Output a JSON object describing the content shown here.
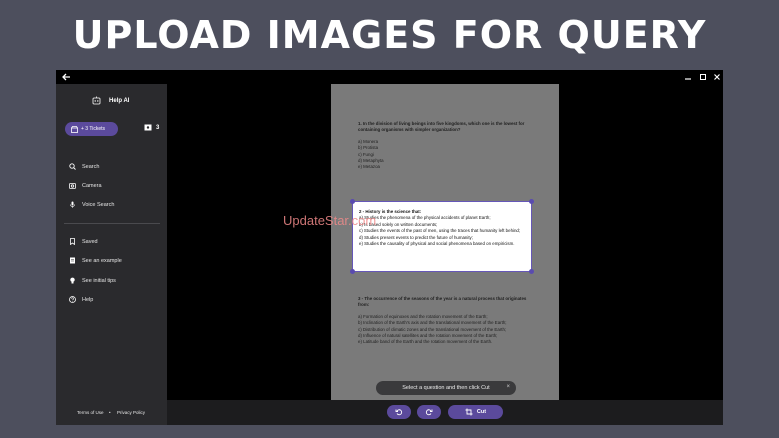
{
  "banner": {
    "title": "UPLOAD IMAGES FOR QUERY"
  },
  "sidebar": {
    "brand": "Help AI",
    "tickets_button": "+ 3 Tickets",
    "ticket_count": "3",
    "nav": [
      {
        "label": "Search",
        "icon": "search-icon"
      },
      {
        "label": "Camera",
        "icon": "camera-icon"
      },
      {
        "label": "Voice Search",
        "icon": "microphone-icon"
      },
      {
        "label": "Saved",
        "icon": "bookmark-icon"
      },
      {
        "label": "See an example",
        "icon": "document-icon"
      },
      {
        "label": "See initial tips",
        "icon": "lightbulb-icon"
      },
      {
        "label": "Help",
        "icon": "help-icon"
      }
    ],
    "footer": {
      "terms": "Terms of Use",
      "separator": "•",
      "privacy": "Privacy Policy"
    }
  },
  "document": {
    "q1_title": "1. In the division of living beings into five kingdoms, which one is the lowest for containing organisms with simpler organization?",
    "q1_options": [
      "a) Monera",
      "b) Protista",
      "c) Fungi",
      "d) Metaphyta",
      "e) Metazoa"
    ],
    "q2_title": "2 - History is the science that:",
    "q2_options": [
      "a) Studies the phenomena of the physical accidents of planet Earth;",
      "b) Is based solely on written documents;",
      "c) Studies the events of the past of men, using the traces that humanity left behind;",
      "d) Studies present events to predict the future of humanity;",
      "e) Studies the causality of physical and social phenomena based on empiricism."
    ],
    "q3_title": "3 - The occurrence of the seasons of the year is a natural process that originates from:",
    "q3_options": [
      "a) Formation of equinoxes and the rotation movement of the Earth;",
      "b) Inclination of the Earth's axis and the translational movement of the Earth;",
      "c) Distribution of climatic zones and the translational movement of the Earth;",
      "d) Influence of natural satellites and the rotation movement of the Earth;",
      "e) Latitude band of the Earth and the rotation movement of the Earth."
    ]
  },
  "watermark": "UpdateStar.com",
  "toast": {
    "text": "Select a question and then click Cut",
    "close": "×"
  },
  "toolbar": {
    "cut_label": "Cut"
  },
  "colors": {
    "accent": "#5b4a9c",
    "sidebar": "#2a2a2d",
    "background": "#4d4f5d"
  }
}
